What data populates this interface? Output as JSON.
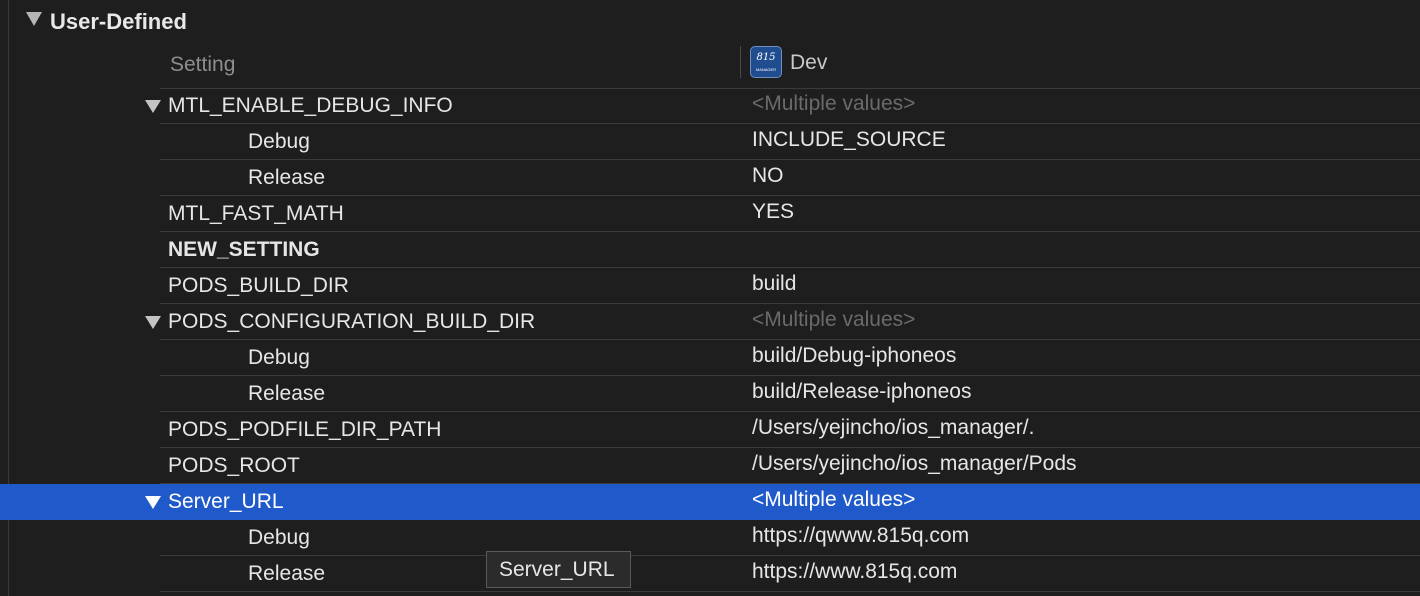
{
  "section": {
    "title": "User-Defined"
  },
  "columns": {
    "setting": "Setting",
    "target": "Dev",
    "target_icon_text": "815",
    "target_icon_subtext": "MANAGER"
  },
  "rows": [
    {
      "name": "MTL_ENABLE_DEBUG_INFO",
      "value": "<Multiple values>",
      "level": 0,
      "expanded": true,
      "bold": false,
      "dim": true,
      "selected": false
    },
    {
      "name": "Debug",
      "value": "INCLUDE_SOURCE",
      "level": 1,
      "expanded": false,
      "bold": false,
      "dim": false,
      "selected": false
    },
    {
      "name": "Release",
      "value": "NO",
      "level": 1,
      "expanded": false,
      "bold": false,
      "dim": false,
      "selected": false
    },
    {
      "name": "MTL_FAST_MATH",
      "value": "YES",
      "level": 0,
      "expanded": false,
      "bold": false,
      "dim": false,
      "selected": false
    },
    {
      "name": "NEW_SETTING",
      "value": "",
      "level": 0,
      "expanded": false,
      "bold": true,
      "dim": false,
      "selected": false
    },
    {
      "name": "PODS_BUILD_DIR",
      "value": "build",
      "level": 0,
      "expanded": false,
      "bold": false,
      "dim": false,
      "selected": false
    },
    {
      "name": "PODS_CONFIGURATION_BUILD_DIR",
      "value": "<Multiple values>",
      "level": 0,
      "expanded": true,
      "bold": false,
      "dim": true,
      "selected": false
    },
    {
      "name": "Debug",
      "value": "build/Debug-iphoneos",
      "level": 1,
      "expanded": false,
      "bold": false,
      "dim": false,
      "selected": false
    },
    {
      "name": "Release",
      "value": "build/Release-iphoneos",
      "level": 1,
      "expanded": false,
      "bold": false,
      "dim": false,
      "selected": false
    },
    {
      "name": "PODS_PODFILE_DIR_PATH",
      "value": "/Users/yejincho/ios_manager/.",
      "level": 0,
      "expanded": false,
      "bold": false,
      "dim": false,
      "selected": false
    },
    {
      "name": "PODS_ROOT",
      "value": "/Users/yejincho/ios_manager/Pods",
      "level": 0,
      "expanded": false,
      "bold": false,
      "dim": false,
      "selected": false
    },
    {
      "name": "Server_URL",
      "value": "<Multiple values>",
      "level": 0,
      "expanded": true,
      "bold": false,
      "dim": false,
      "selected": true
    },
    {
      "name": "Debug",
      "value": "https://qwww.815q.com",
      "level": 1,
      "expanded": false,
      "bold": false,
      "dim": false,
      "selected": false
    },
    {
      "name": "Release",
      "value": "https://www.815q.com",
      "level": 1,
      "expanded": false,
      "bold": false,
      "dim": false,
      "selected": false
    }
  ],
  "tooltip": {
    "text": "Server_URL"
  },
  "colors": {
    "background": "#1e1e1e",
    "selection": "#2059c9",
    "dim_text": "#6a6a6a"
  }
}
